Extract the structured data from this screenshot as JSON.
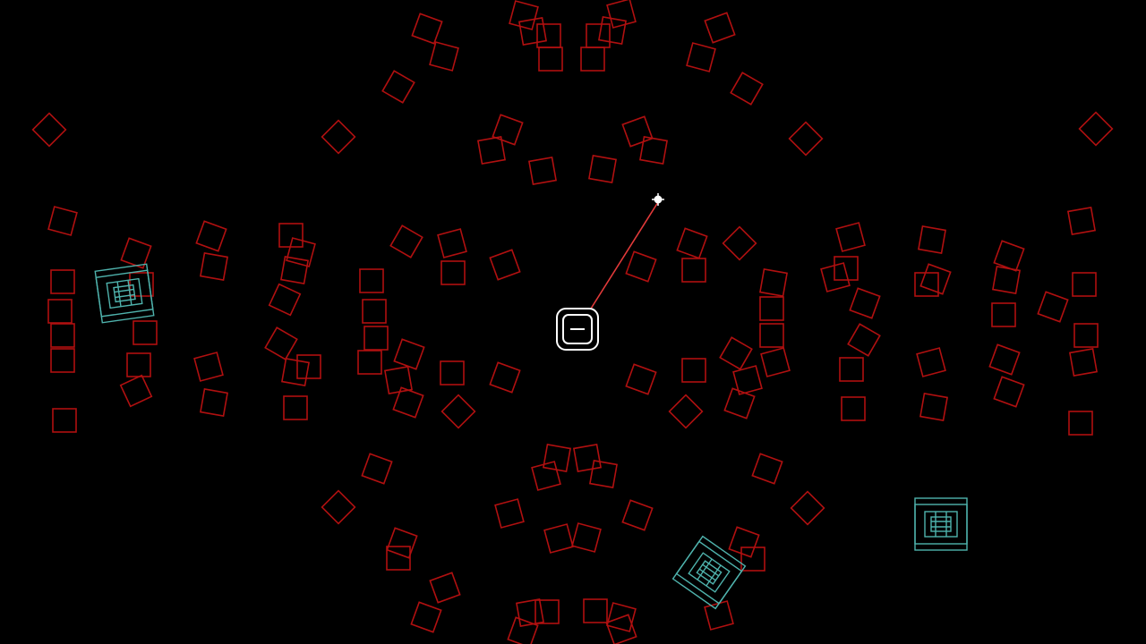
{
  "game": {
    "background_color": "#000000",
    "block_color": "#b01010",
    "player_color": "#ffffff",
    "aim_line_color": "#e23a3a",
    "enemy_color": "#4fb3ad"
  },
  "entities": {
    "player": {
      "icon": "player-ship-icon"
    },
    "aim_reticle": {
      "icon": "crosshair-icon"
    },
    "enemies": [
      {
        "name": "enemy-crate-1",
        "icon": "crate-icon"
      },
      {
        "name": "enemy-crate-2",
        "icon": "crate-icon"
      },
      {
        "name": "enemy-crate-3",
        "icon": "crate-icon"
      }
    ]
  }
}
